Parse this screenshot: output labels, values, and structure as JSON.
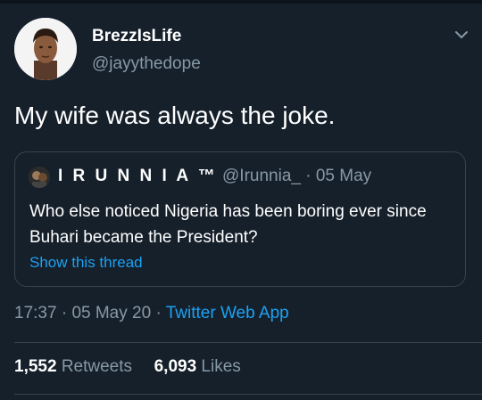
{
  "author": {
    "display_name": "BrezzIsLife",
    "handle": "@jayythedope",
    "avatar_icon": "user-avatar"
  },
  "tweet": {
    "text": "My wife was always the joke."
  },
  "quoted_tweet": {
    "display_name": "I R U N N I A ™",
    "handle": "@Irunnia_",
    "separator": "·",
    "date": "05 May",
    "text": "Who else noticed Nigeria has been boring ever since Buhari became the President?",
    "show_thread_label": "Show this thread"
  },
  "meta": {
    "time": "17:37",
    "dot1": "·",
    "date": "05 May 20",
    "dot2": "·",
    "source": "Twitter Web App"
  },
  "stats": {
    "retweets_count": "1,552",
    "retweets_label": "Retweets",
    "likes_count": "6,093",
    "likes_label": "Likes"
  },
  "colors": {
    "background": "#15202b",
    "text": "#ffffff",
    "secondary_text": "#8899a6",
    "accent": "#1da1f2",
    "border": "#38444d"
  }
}
